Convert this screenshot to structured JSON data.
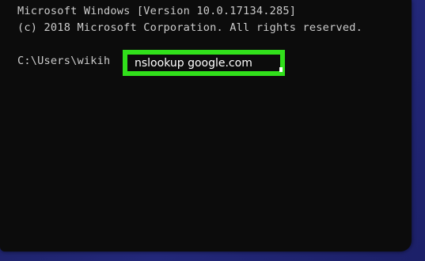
{
  "terminal": {
    "header_line_1": "Microsoft Windows [Version 10.0.17134.285]",
    "header_line_2": "(c) 2018 Microsoft Corporation. All rights reserved.",
    "prompt": "C:\\Users\\wikih",
    "command": "nslookup google.com"
  },
  "colors": {
    "background": "#0c0c0c",
    "text": "#cccccc",
    "highlight_border": "#31e01b",
    "desktop": "#1b1f5c"
  }
}
